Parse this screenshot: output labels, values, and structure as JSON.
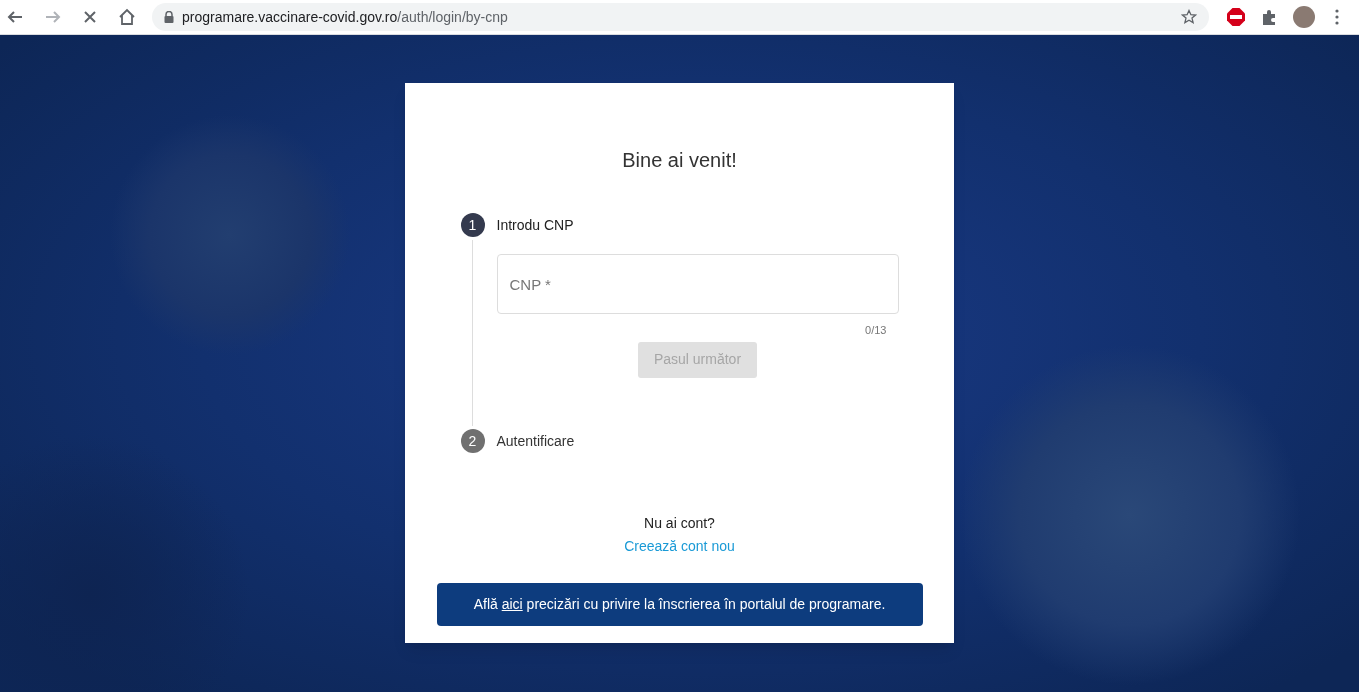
{
  "browser": {
    "url_host": "programare.vaccinare-covid.gov.ro",
    "url_path": "/auth/login/by-cnp",
    "loading": true
  },
  "card": {
    "title": "Bine ai venit!",
    "steps": [
      {
        "number": "1",
        "label": "Introdu CNP",
        "selected": true
      },
      {
        "number": "2",
        "label": "Autentificare",
        "selected": false
      }
    ],
    "cnp_field": {
      "placeholder": "CNP *",
      "counter": "0/13"
    },
    "next_button": {
      "label": "Pasul următor",
      "disabled": true
    },
    "no_account": "Nu ai cont?",
    "create_account_link": "Creează cont nou",
    "banner": {
      "before": "Află",
      "link": "aici",
      "after": "precizări cu privire la înscrierea în portalul de programare."
    }
  }
}
